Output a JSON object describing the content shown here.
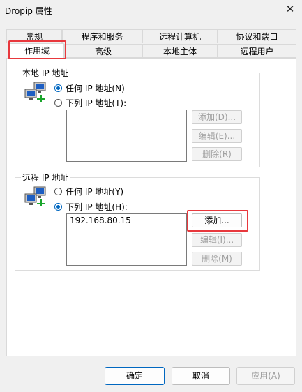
{
  "window": {
    "title": "Dropip 属性",
    "close": "✕"
  },
  "tabs": {
    "row1": [
      "常规",
      "程序和服务",
      "远程计算机",
      "协议和端口"
    ],
    "row2": [
      "作用域",
      "高级",
      "本地主体",
      "远程用户"
    ],
    "active": "作用域"
  },
  "local": {
    "legend": "本地 IP 地址",
    "opt_any": "任何 IP 地址(N)",
    "opt_list": "下列 IP 地址(T):",
    "selected": "任何 IP 地址(N)",
    "add": "添加(D)...",
    "edit": "编辑(E)...",
    "delete": "删除(R)"
  },
  "remote": {
    "legend": "远程 IP 地址",
    "opt_any": "任何 IP 地址(Y)",
    "opt_list": "下列 IP 地址(H):",
    "selected": "下列 IP 地址(H):",
    "list": [
      "192.168.80.15"
    ],
    "add": "添加...",
    "edit": "编辑(I)...",
    "delete": "删除(M)"
  },
  "footer": {
    "ok": "确定",
    "cancel": "取消",
    "apply": "应用(A)"
  },
  "colors": {
    "accent": "#0067c0",
    "highlight": "#e8383d"
  },
  "icons": {
    "network": "network-computers-icon"
  }
}
